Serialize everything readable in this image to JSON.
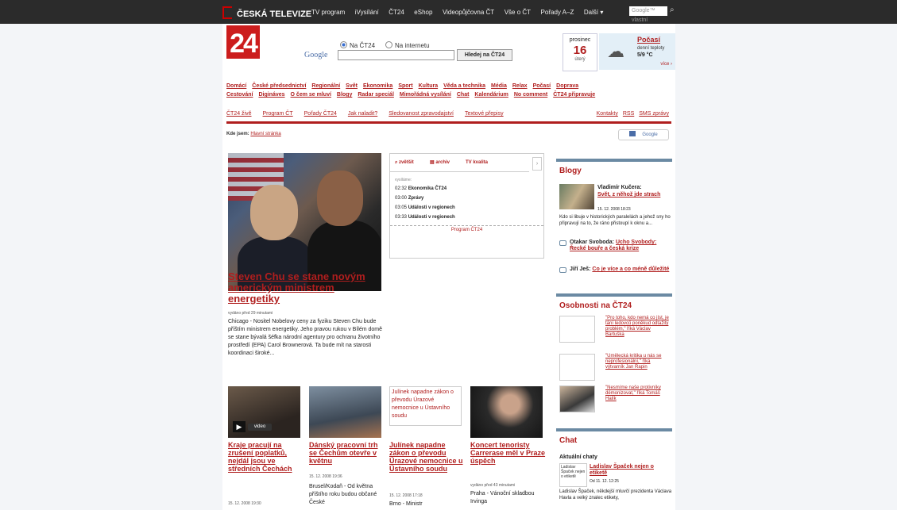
{
  "topbar": {
    "brand": "ČESKÁ TELEVIZE",
    "nav": [
      "TV program",
      "iVysílání",
      "ČT24",
      "eShop",
      "Videopůjčovna ČT",
      "Vše o ČT",
      "Pořady A–Z",
      "Další ▾"
    ],
    "search_placeholder": "Google™ vlastní vyhled"
  },
  "header": {
    "logo": "24",
    "google_logo": "Google",
    "radio_ct24": "Na ČT24",
    "radio_internet": "Na internetu",
    "search_button": "Hledej na ČT24",
    "date": {
      "month": "prosinec",
      "day": "16",
      "weekday": "úterý"
    },
    "weather": {
      "title": "Počasí",
      "subtitle": "denní teploty",
      "value": "5/9 °C",
      "more": "více ›"
    }
  },
  "rubriky_row1": [
    "Domácí",
    "České předsednictví",
    "Regionální",
    "Svět",
    "Ekonomika",
    "Sport",
    "Kultura",
    "Věda a technika",
    "Média",
    "Relax",
    "Počasí",
    "Doprava"
  ],
  "rubriky_row2": [
    "Cestování",
    "Digináves",
    "O čem se mluví",
    "Blogy",
    "Radar speciál",
    "Mimořádná vysílání",
    "Chat",
    "Kalendárium",
    "No comment",
    "ČT24 připravuje"
  ],
  "subnav_left": [
    "ČT24 živě",
    "Program ČT",
    "Pořady ČT24",
    "Jak naladit?",
    "Sledovanost zpravodajství",
    "Textové přepisy"
  ],
  "subnav_right": [
    "Kontakty",
    "RSS",
    "SMS zprávy"
  ],
  "breadcrumb": {
    "label": "Kde jsem:",
    "link": "Hlavní stránka"
  },
  "google_badge": "Google",
  "main_story": {
    "title": "Steven Chu se stane novým americkým ministrem energetiky",
    "time": "vydáno před 29 minutami",
    "perex": "Chicago - Nositel Nobelovy ceny za fyziku Steven Chu bude příštím ministrem energetiky. Jeho pravou rukou v Bílém domě se stane bývalá šéfka národní agentury pro ochranu životního prostředí (EPA) Carol Brownerová. Ta bude mít na starosti koordinaci široké..."
  },
  "tv": {
    "tabs": [
      "zvětšit",
      "archiv",
      "TV kvalita"
    ],
    "label": "vysíláme:",
    "rows": [
      {
        "time": "02:32",
        "title": "Ekonomika ČT24"
      },
      {
        "time": "03:00",
        "title": "Zprávy"
      },
      {
        "time": "03:05",
        "title": "Události v regionech"
      },
      {
        "time": "03:33",
        "title": "Události v regionech"
      }
    ],
    "program_link": "Program ČT24",
    "next": "›"
  },
  "stories": [
    {
      "title": "Kraje pracují na zrušení poplatků, nejdál jsou ve středních Čechách",
      "meta": "15. 12. 2008 19:30",
      "text": "",
      "badge": "video"
    },
    {
      "title": "Dánský pracovní trh se Čechům otevře v květnu",
      "meta": "15. 12. 2008 19:36",
      "text": "Brusel/Kodaň - Od května příštího roku budou občané České"
    },
    {
      "title": "Julínek napadne zákon o převodu Úrazové nemocnice u Ústavního soudu",
      "meta": "15. 12. 2008 17:18",
      "text": "Brno - Ministr",
      "broken_alt": "Julínek napadne zákon o převodu Úrazové nemocnice u Ústavního soudu"
    },
    {
      "title": "Koncert tenoristy Carrerase měl v Praze úspěch",
      "meta": "vydáno před 43 minutami",
      "text": "Praha - Vánoční skladbou Irvinga"
    }
  ],
  "blogy": {
    "title": "Blogy",
    "author": "Vladimír Kučera:",
    "headline": "Svět, z něhož jde strach",
    "date": "15. 12. 2008 18:23",
    "text": "Kdo si libuje v historických paralelách a jehož sny ho připravují na to, že ráno přistoupí k oknu a...",
    "items": [
      {
        "author": "Otakar Svoboda:",
        "link": "Ucho Svobody: Řecké bouře a česká krize"
      },
      {
        "author": "Jiří Ješ:",
        "link": "Co je více a co méně důležité"
      }
    ]
  },
  "osobnosti": {
    "title": "Osobnosti na ČT24",
    "items": [
      "\"Pro toho, kdo nemá co jíst, je tání ledovců poněkud odtažitý problém,\" říká Václav Bartuška",
      "\"Umělecká kritika u nás se neprofesionální,\" říká výtvarník Jan Rapin",
      "\"Nesmíme naše protivníky démonizovat,\" říká Tomáš Halík"
    ]
  },
  "chat": {
    "title": "Chat",
    "sub": "Aktuální chaty",
    "img_alt": "Ladislav Špaček nejen o etiketě",
    "link": "Ladislav Špaček nejen o etiketě",
    "date": "Od 11. 12. 12:25",
    "text": "Ladislav Špaček, někdejší mluvčí prezidenta Václava Havla a velký znalec etikety,"
  }
}
